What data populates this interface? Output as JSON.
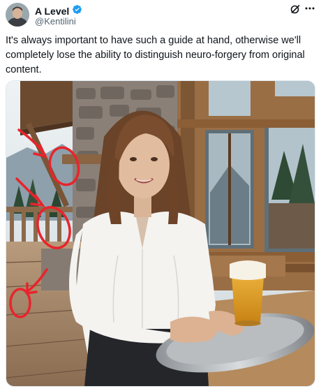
{
  "author": {
    "display_name": "A Level",
    "handle": "@Kentilini",
    "verified": true,
    "avatar_icon": "avatar-photo-icon"
  },
  "post": {
    "text": "It's always important to have such a guide at hand, otherwise we'll completely lose the ability to distinguish neuro-forgery from original content."
  },
  "colors": {
    "verified_badge": "#1d9bf0",
    "annotation_red": "#e8242c",
    "handle_gray": "#536471"
  },
  "icons": {
    "grok": "grok-icon",
    "more": "more-options-icon"
  }
}
